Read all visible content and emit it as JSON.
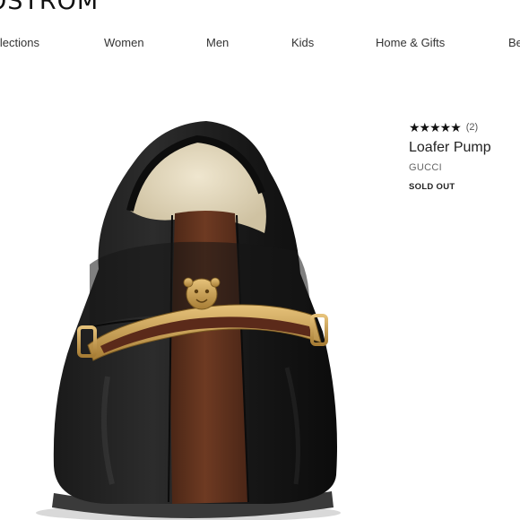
{
  "header": {
    "brand": "OSTROM"
  },
  "nav": {
    "items": [
      {
        "label": "llections"
      },
      {
        "label": "Women"
      },
      {
        "label": "Men"
      },
      {
        "label": "Kids"
      },
      {
        "label": "Home & Gifts"
      },
      {
        "label": "Be"
      }
    ]
  },
  "product": {
    "stars": "★★★★★",
    "rating_count": "(2)",
    "title": "Loafer Pump",
    "brand": "GUCCI",
    "status": "SOLD OUT"
  }
}
